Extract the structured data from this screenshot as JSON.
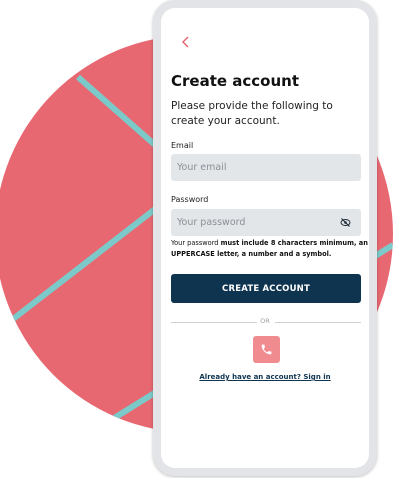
{
  "header": {
    "title": "Create account",
    "subtitle": "Please provide the following to create your account."
  },
  "form": {
    "email_label": "Email",
    "email_placeholder": "Your email",
    "password_label": "Password",
    "password_placeholder": "Your password",
    "hint_prefix": "Your password ",
    "hint_bold": "must include 8 characters minimum, an UPPERCASE letter, a number and a symbol."
  },
  "actions": {
    "create_label": "CREATE ACCOUNT",
    "or_label": "OR",
    "signin_label": "Already have an account? Sign in"
  },
  "colors": {
    "accent": "#e86872",
    "primary": "#0f3450",
    "stripe": "#7bcac9"
  },
  "icons": {
    "back": "chevron-left-icon",
    "visibility": "eye-slash-icon",
    "phone": "phone-icon"
  }
}
